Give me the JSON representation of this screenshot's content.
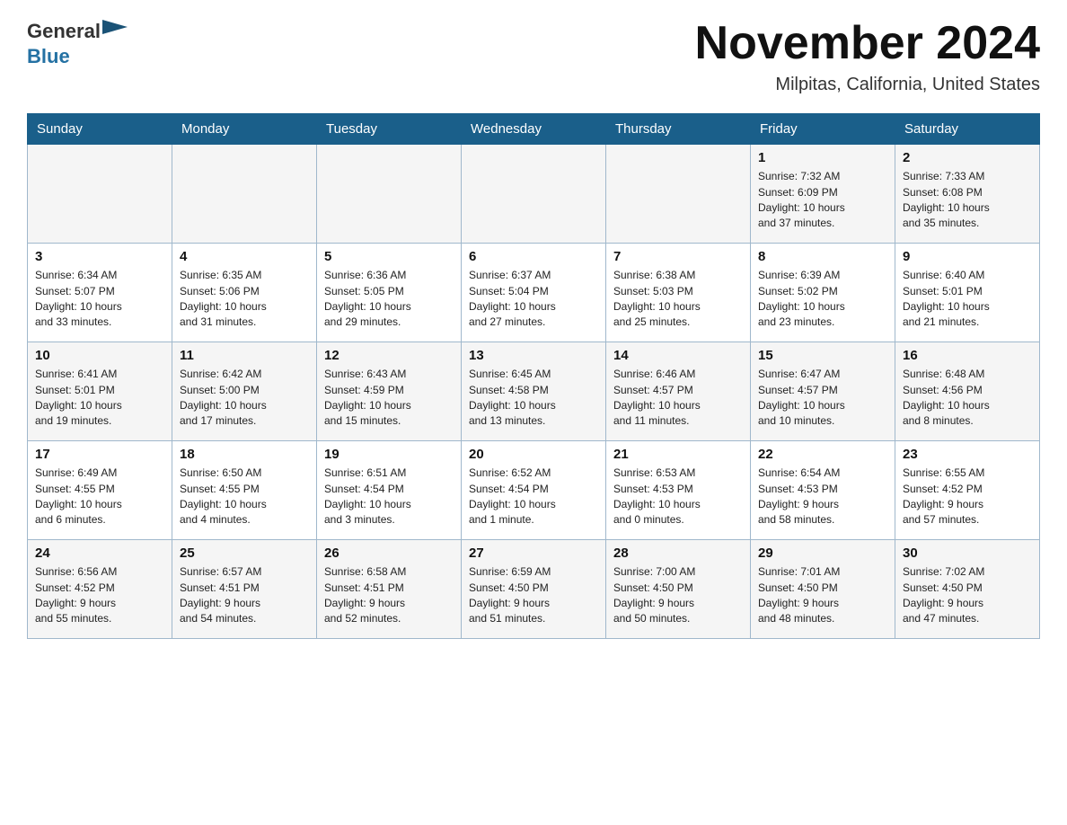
{
  "header": {
    "logo_general": "General",
    "logo_blue": "Blue",
    "title": "November 2024",
    "location": "Milpitas, California, United States"
  },
  "weekdays": [
    "Sunday",
    "Monday",
    "Tuesday",
    "Wednesday",
    "Thursday",
    "Friday",
    "Saturday"
  ],
  "weeks": [
    [
      {
        "day": "",
        "info": ""
      },
      {
        "day": "",
        "info": ""
      },
      {
        "day": "",
        "info": ""
      },
      {
        "day": "",
        "info": ""
      },
      {
        "day": "",
        "info": ""
      },
      {
        "day": "1",
        "info": "Sunrise: 7:32 AM\nSunset: 6:09 PM\nDaylight: 10 hours\nand 37 minutes."
      },
      {
        "day": "2",
        "info": "Sunrise: 7:33 AM\nSunset: 6:08 PM\nDaylight: 10 hours\nand 35 minutes."
      }
    ],
    [
      {
        "day": "3",
        "info": "Sunrise: 6:34 AM\nSunset: 5:07 PM\nDaylight: 10 hours\nand 33 minutes."
      },
      {
        "day": "4",
        "info": "Sunrise: 6:35 AM\nSunset: 5:06 PM\nDaylight: 10 hours\nand 31 minutes."
      },
      {
        "day": "5",
        "info": "Sunrise: 6:36 AM\nSunset: 5:05 PM\nDaylight: 10 hours\nand 29 minutes."
      },
      {
        "day": "6",
        "info": "Sunrise: 6:37 AM\nSunset: 5:04 PM\nDaylight: 10 hours\nand 27 minutes."
      },
      {
        "day": "7",
        "info": "Sunrise: 6:38 AM\nSunset: 5:03 PM\nDaylight: 10 hours\nand 25 minutes."
      },
      {
        "day": "8",
        "info": "Sunrise: 6:39 AM\nSunset: 5:02 PM\nDaylight: 10 hours\nand 23 minutes."
      },
      {
        "day": "9",
        "info": "Sunrise: 6:40 AM\nSunset: 5:01 PM\nDaylight: 10 hours\nand 21 minutes."
      }
    ],
    [
      {
        "day": "10",
        "info": "Sunrise: 6:41 AM\nSunset: 5:01 PM\nDaylight: 10 hours\nand 19 minutes."
      },
      {
        "day": "11",
        "info": "Sunrise: 6:42 AM\nSunset: 5:00 PM\nDaylight: 10 hours\nand 17 minutes."
      },
      {
        "day": "12",
        "info": "Sunrise: 6:43 AM\nSunset: 4:59 PM\nDaylight: 10 hours\nand 15 minutes."
      },
      {
        "day": "13",
        "info": "Sunrise: 6:45 AM\nSunset: 4:58 PM\nDaylight: 10 hours\nand 13 minutes."
      },
      {
        "day": "14",
        "info": "Sunrise: 6:46 AM\nSunset: 4:57 PM\nDaylight: 10 hours\nand 11 minutes."
      },
      {
        "day": "15",
        "info": "Sunrise: 6:47 AM\nSunset: 4:57 PM\nDaylight: 10 hours\nand 10 minutes."
      },
      {
        "day": "16",
        "info": "Sunrise: 6:48 AM\nSunset: 4:56 PM\nDaylight: 10 hours\nand 8 minutes."
      }
    ],
    [
      {
        "day": "17",
        "info": "Sunrise: 6:49 AM\nSunset: 4:55 PM\nDaylight: 10 hours\nand 6 minutes."
      },
      {
        "day": "18",
        "info": "Sunrise: 6:50 AM\nSunset: 4:55 PM\nDaylight: 10 hours\nand 4 minutes."
      },
      {
        "day": "19",
        "info": "Sunrise: 6:51 AM\nSunset: 4:54 PM\nDaylight: 10 hours\nand 3 minutes."
      },
      {
        "day": "20",
        "info": "Sunrise: 6:52 AM\nSunset: 4:54 PM\nDaylight: 10 hours\nand 1 minute."
      },
      {
        "day": "21",
        "info": "Sunrise: 6:53 AM\nSunset: 4:53 PM\nDaylight: 10 hours\nand 0 minutes."
      },
      {
        "day": "22",
        "info": "Sunrise: 6:54 AM\nSunset: 4:53 PM\nDaylight: 9 hours\nand 58 minutes."
      },
      {
        "day": "23",
        "info": "Sunrise: 6:55 AM\nSunset: 4:52 PM\nDaylight: 9 hours\nand 57 minutes."
      }
    ],
    [
      {
        "day": "24",
        "info": "Sunrise: 6:56 AM\nSunset: 4:52 PM\nDaylight: 9 hours\nand 55 minutes."
      },
      {
        "day": "25",
        "info": "Sunrise: 6:57 AM\nSunset: 4:51 PM\nDaylight: 9 hours\nand 54 minutes."
      },
      {
        "day": "26",
        "info": "Sunrise: 6:58 AM\nSunset: 4:51 PM\nDaylight: 9 hours\nand 52 minutes."
      },
      {
        "day": "27",
        "info": "Sunrise: 6:59 AM\nSunset: 4:50 PM\nDaylight: 9 hours\nand 51 minutes."
      },
      {
        "day": "28",
        "info": "Sunrise: 7:00 AM\nSunset: 4:50 PM\nDaylight: 9 hours\nand 50 minutes."
      },
      {
        "day": "29",
        "info": "Sunrise: 7:01 AM\nSunset: 4:50 PM\nDaylight: 9 hours\nand 48 minutes."
      },
      {
        "day": "30",
        "info": "Sunrise: 7:02 AM\nSunset: 4:50 PM\nDaylight: 9 hours\nand 47 minutes."
      }
    ]
  ]
}
